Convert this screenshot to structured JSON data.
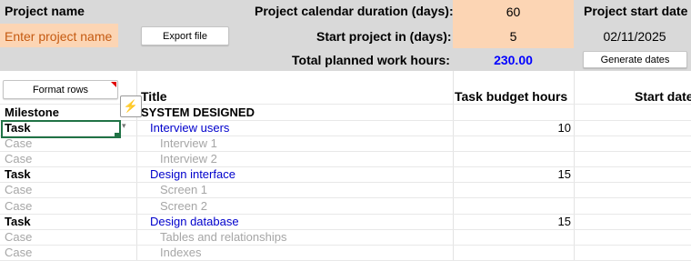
{
  "header": {
    "project_name_label": "Project name",
    "project_name_value": "Enter project name",
    "export_button": "Export file",
    "calendar_duration_label": "Project calendar duration (days):",
    "calendar_duration_value": "60",
    "start_in_label": "Start project in (days):",
    "start_in_value": "5",
    "total_hours_label": "Total planned work hours:",
    "total_hours_value": "230.00",
    "start_date_label": "Project start date",
    "start_date_value": "02/11/2025",
    "generate_button": "Generate dates"
  },
  "toolbar": {
    "format_rows_button": "Format rows"
  },
  "columns": {
    "title": "Title",
    "task_budget_hours": "Task budget hours",
    "start_date": "Start date"
  },
  "milestone_header": "Milestone",
  "milestone_title": "SYSTEM DESIGNED",
  "rows": [
    {
      "type": "Task",
      "title": "Interview users",
      "hours": "10",
      "kind": "task"
    },
    {
      "type": "Case",
      "title": "Interview 1",
      "hours": "",
      "kind": "case"
    },
    {
      "type": "Case",
      "title": "Interview 2",
      "hours": "",
      "kind": "case"
    },
    {
      "type": "Task",
      "title": "Design interface",
      "hours": "15",
      "kind": "task"
    },
    {
      "type": "Case",
      "title": "Screen 1",
      "hours": "",
      "kind": "case"
    },
    {
      "type": "Case",
      "title": "Screen 2",
      "hours": "",
      "kind": "case"
    },
    {
      "type": "Task",
      "title": "Design database",
      "hours": "15",
      "kind": "task"
    },
    {
      "type": "Case",
      "title": "Tables and relationships",
      "hours": "",
      "kind": "case"
    },
    {
      "type": "Case",
      "title": "Indexes",
      "hours": "",
      "kind": "case"
    }
  ],
  "colors": {
    "header_bg": "#d9d9d9",
    "input_bg": "#fcd5b4",
    "task_title": "#0000cc",
    "total_value": "#0000ff",
    "case_text": "#a6a6a6",
    "selected_border": "#217346"
  }
}
